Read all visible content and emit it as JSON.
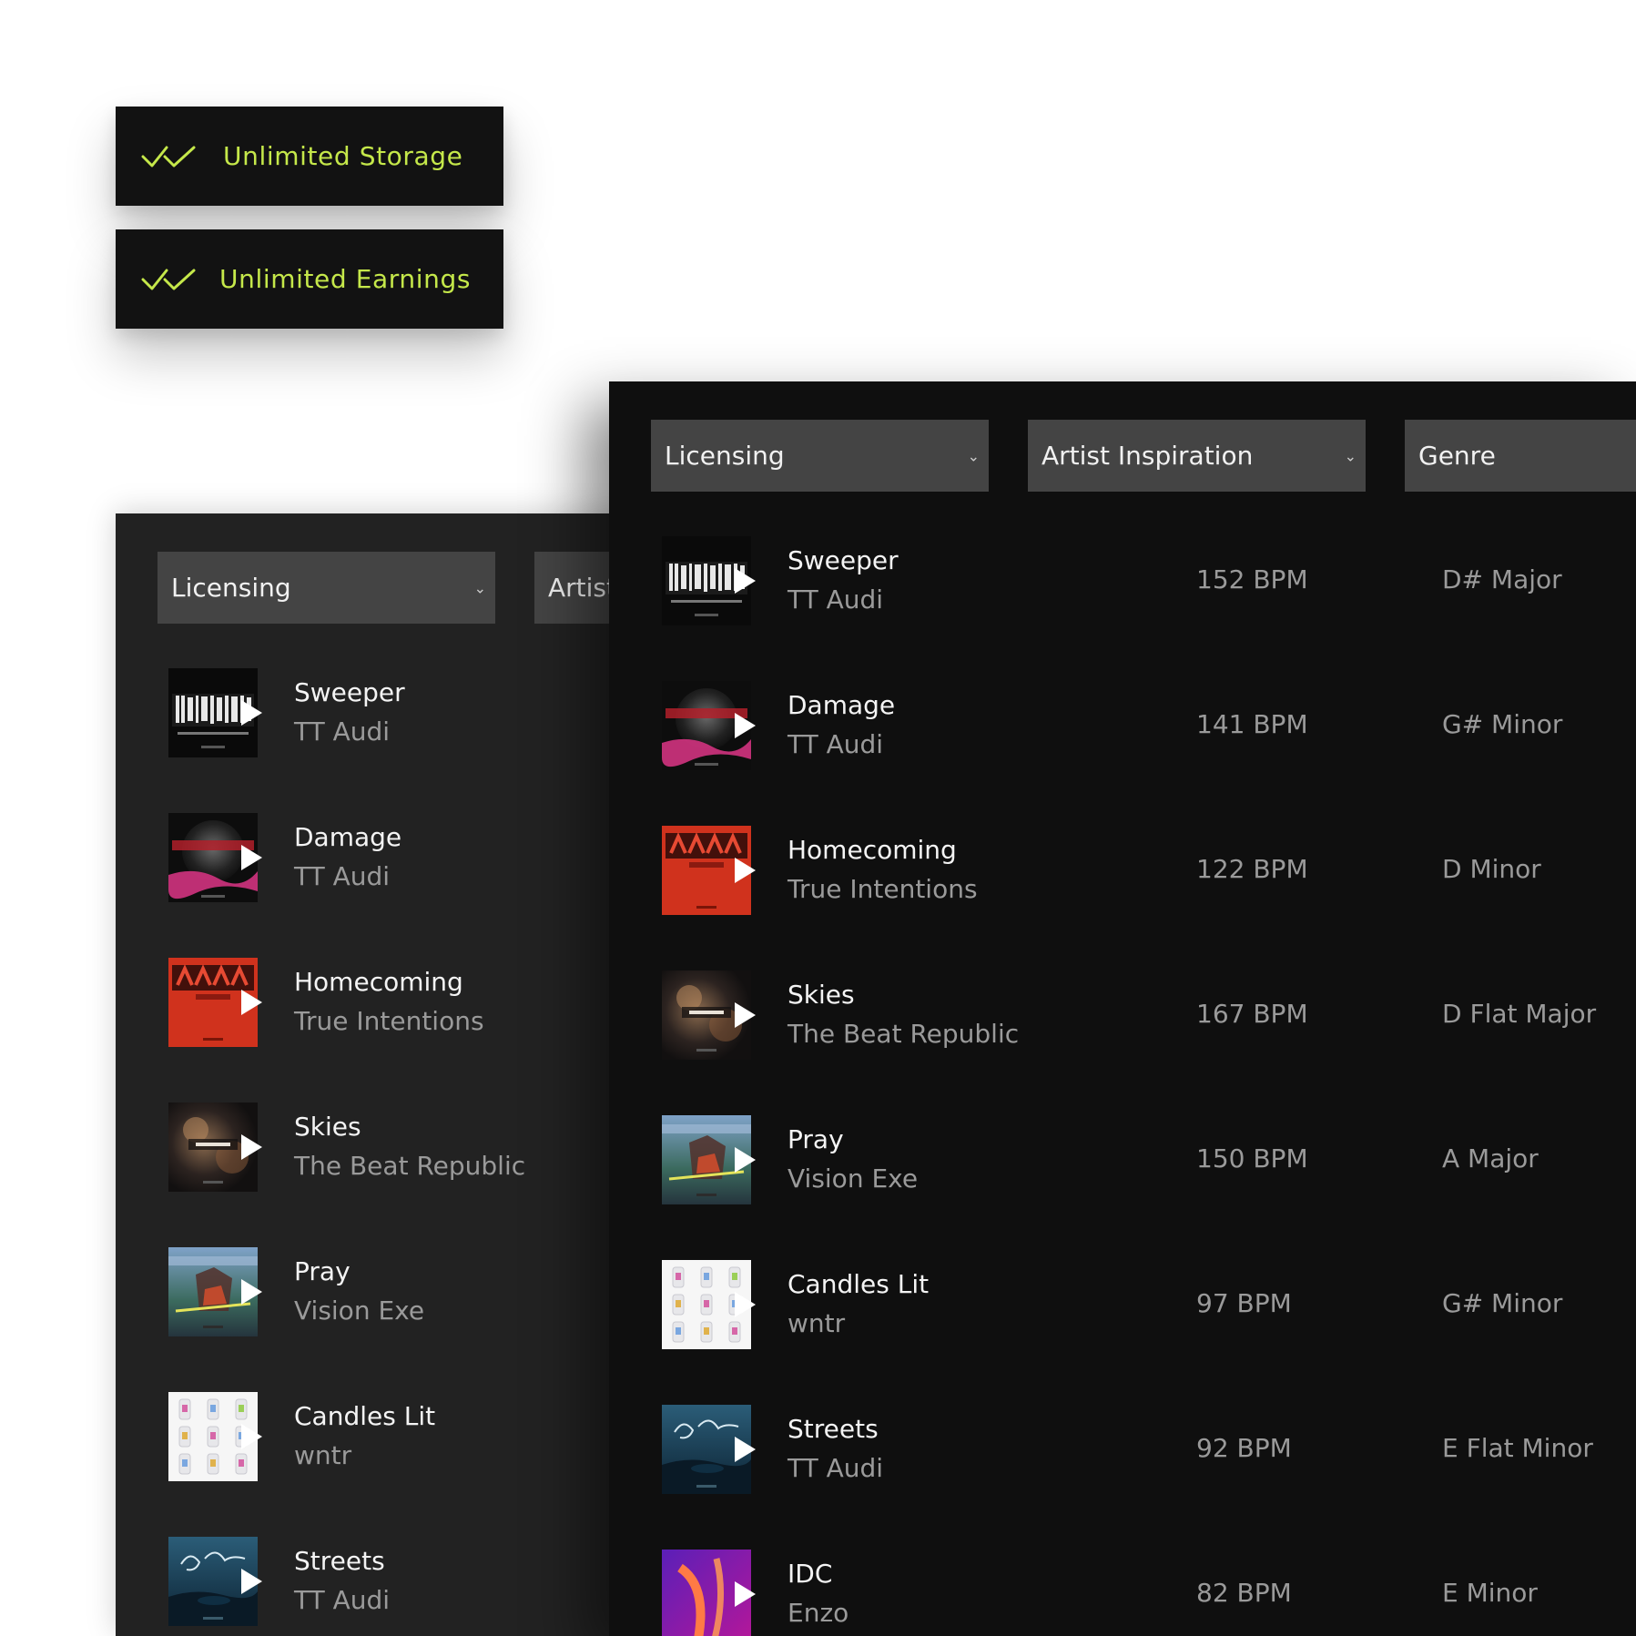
{
  "features": [
    {
      "label": "Unlimited Storage",
      "icon": "double-check-icon"
    },
    {
      "label": "Unlimited Earnings",
      "icon": "double-check-icon"
    }
  ],
  "colors": {
    "accent": "#c5e84a",
    "badge_bg": "#121212",
    "panel_front_bg": "#0f0f0f",
    "panel_back_bg": "#222222",
    "filter_bg": "#444444",
    "title_text": "#f4f4f4",
    "secondary_text": "#9a9a9a"
  },
  "back_panel": {
    "filters": [
      {
        "label": "Licensing"
      },
      {
        "label": "Artist"
      }
    ],
    "tracks": [
      {
        "title": "Sweeper",
        "artist": "TT Audi",
        "cover": "hologram"
      },
      {
        "title": "Damage",
        "artist": "TT Audi",
        "cover": "world"
      },
      {
        "title": "Homecoming",
        "artist": "True Intentions",
        "cover": "grain"
      },
      {
        "title": "Skies",
        "artist": "The Beat Republic",
        "cover": "detox"
      },
      {
        "title": "Pray",
        "artist": "Vision Exe",
        "cover": "pray"
      },
      {
        "title": "Candles Lit",
        "artist": "wntr",
        "cover": "candles"
      },
      {
        "title": "Streets",
        "artist": "TT Audi",
        "cover": "nights"
      }
    ]
  },
  "front_panel": {
    "filters": [
      {
        "label": "Licensing"
      },
      {
        "label": "Artist Inspiration"
      },
      {
        "label": "Genre"
      }
    ],
    "tracks": [
      {
        "title": "Sweeper",
        "artist": "TT Audi",
        "bpm": "152 BPM",
        "key": "D# Major",
        "cover": "hologram"
      },
      {
        "title": "Damage",
        "artist": "TT Audi",
        "bpm": "141 BPM",
        "key": "G# Minor",
        "cover": "world"
      },
      {
        "title": "Homecoming",
        "artist": "True Intentions",
        "bpm": "122 BPM",
        "key": "D Minor",
        "cover": "grain"
      },
      {
        "title": "Skies",
        "artist": "The Beat Republic",
        "bpm": "167 BPM",
        "key": "D Flat Major",
        "cover": "detox"
      },
      {
        "title": "Pray",
        "artist": "Vision Exe",
        "bpm": "150 BPM",
        "key": "A Major",
        "cover": "pray"
      },
      {
        "title": "Candles Lit",
        "artist": "wntr",
        "bpm": "97 BPM",
        "key": "G# Minor",
        "cover": "candles"
      },
      {
        "title": "Streets",
        "artist": "TT Audi",
        "bpm": "92 BPM",
        "key": "E Flat Minor",
        "cover": "nights"
      },
      {
        "title": "IDC",
        "artist": "Enzo",
        "bpm": "82 BPM",
        "key": "E Minor",
        "cover": "idc"
      }
    ]
  }
}
